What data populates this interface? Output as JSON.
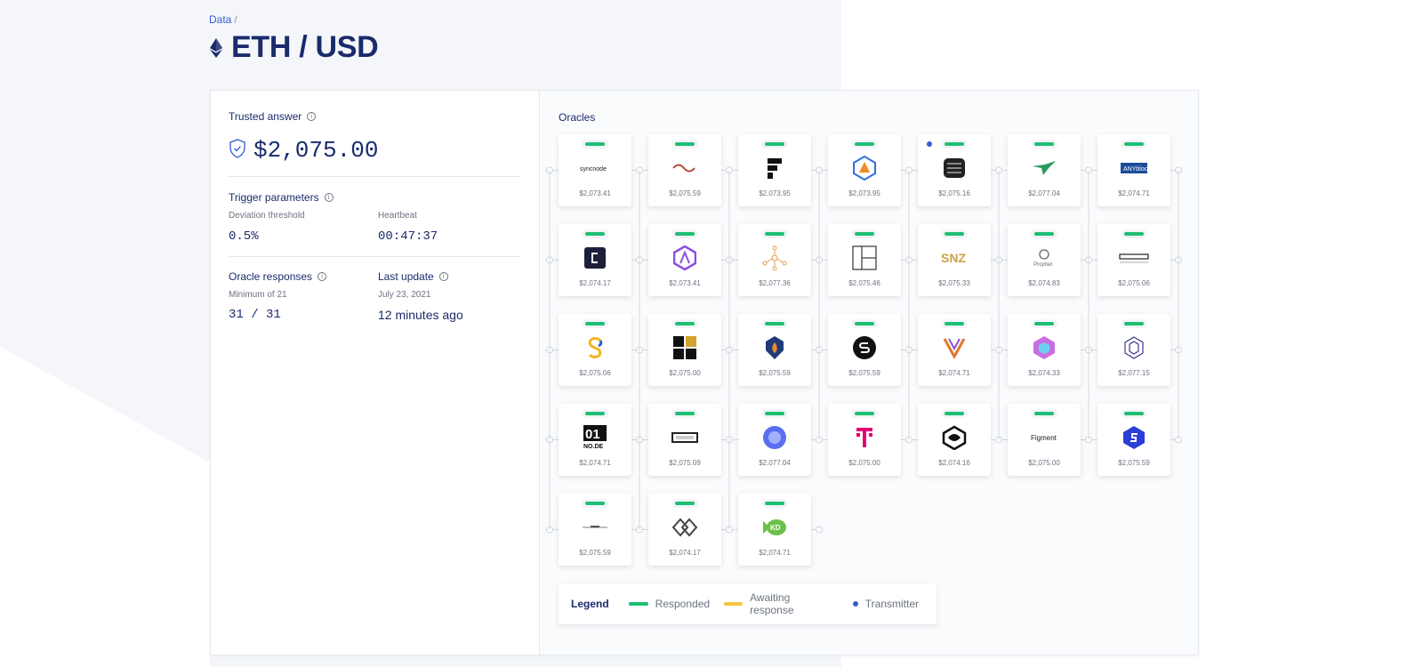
{
  "breadcrumb": {
    "root": "Data",
    "sep": "/"
  },
  "page": {
    "title": "ETH / USD"
  },
  "trusted": {
    "label": "Trusted answer",
    "value": "$2,075.00"
  },
  "trigger": {
    "label": "Trigger parameters",
    "deviation_label": "Deviation threshold",
    "deviation_value": "0.5%",
    "heartbeat_label": "Heartbeat",
    "heartbeat_value": "00:47:37"
  },
  "responses": {
    "label": "Oracle responses",
    "minimum": "Minimum of 21",
    "value": "31 / 31"
  },
  "last_update": {
    "label": "Last update",
    "date": "July 23, 2021",
    "relative": "12 minutes ago"
  },
  "oracles": {
    "title": "Oracles",
    "items": [
      {
        "logo": "syncnode-logo",
        "value": "$2,073.41",
        "status": "responded",
        "transmitter": false
      },
      {
        "logo": "wave-logo",
        "value": "$2,075.59",
        "status": "responded",
        "transmitter": false
      },
      {
        "logo": "f-logo",
        "value": "$2,073.95",
        "status": "responded",
        "transmitter": false
      },
      {
        "logo": "hexagon-flame-logo",
        "value": "$2,073.95",
        "status": "responded",
        "transmitter": false
      },
      {
        "logo": "stack-logo",
        "value": "$2,075.16",
        "status": "responded",
        "transmitter": true
      },
      {
        "logo": "bird-logo",
        "value": "$2,077.04",
        "status": "responded",
        "transmitter": false
      },
      {
        "logo": "anyblock-logo",
        "value": "$2,074.71",
        "status": "responded",
        "transmitter": false
      },
      {
        "logo": "tc-logo",
        "value": "$2,074.17",
        "status": "responded",
        "transmitter": false
      },
      {
        "logo": "a-hexagon-logo",
        "value": "$2,073.41",
        "status": "responded",
        "transmitter": false
      },
      {
        "logo": "network-nodes-logo",
        "value": "$2,077.36",
        "status": "responded",
        "transmitter": false
      },
      {
        "logo": "window-logo",
        "value": "$2,075.46",
        "status": "responded",
        "transmitter": false
      },
      {
        "logo": "snz-logo",
        "value": "$2,075.33",
        "status": "responded",
        "transmitter": false
      },
      {
        "logo": "prophet-logo",
        "value": "$2,074.83",
        "status": "responded",
        "transmitter": false
      },
      {
        "logo": "ceo-logo",
        "value": "$2,075.06",
        "status": "responded",
        "transmitter": false
      },
      {
        "logo": "chain-s-logo",
        "value": "$2,075.06",
        "status": "responded",
        "transmitter": false
      },
      {
        "logo": "blocks-logo",
        "value": "$2,075.00",
        "status": "responded",
        "transmitter": false
      },
      {
        "logo": "shield-flame-logo",
        "value": "$2,075.59",
        "status": "responded",
        "transmitter": false
      },
      {
        "logo": "circle-s-logo",
        "value": "$2,075.59",
        "status": "responded",
        "transmitter": false
      },
      {
        "logo": "v-logo",
        "value": "$2,074.71",
        "status": "responded",
        "transmitter": false
      },
      {
        "logo": "cube-logo",
        "value": "$2,074.33",
        "status": "responded",
        "transmitter": false
      },
      {
        "logo": "hex-outline-logo",
        "value": "$2,077.15",
        "status": "responded",
        "transmitter": false
      },
      {
        "logo": "01-node-logo",
        "value": "$2,074.71",
        "status": "responded",
        "transmitter": false
      },
      {
        "logo": "rect-badge-logo",
        "value": "$2,075.09",
        "status": "responded",
        "transmitter": false
      },
      {
        "logo": "blue-blob-logo",
        "value": "$2,077.04",
        "status": "responded",
        "transmitter": false
      },
      {
        "logo": "t-mobile-logo",
        "value": "$2,075.00",
        "status": "responded",
        "transmitter": false
      },
      {
        "logo": "hex-eye-logo",
        "value": "$2,074.16",
        "status": "responded",
        "transmitter": false
      },
      {
        "logo": "figment-logo",
        "value": "$2,075.00",
        "status": "responded",
        "transmitter": false
      },
      {
        "logo": "blue-s-hex-logo",
        "value": "$2,075.59",
        "status": "responded",
        "transmitter": false
      },
      {
        "logo": "line-logo",
        "value": "$2,075.59",
        "status": "responded",
        "transmitter": false
      },
      {
        "logo": "diamond-logo",
        "value": "$2,074.17",
        "status": "responded",
        "transmitter": false
      },
      {
        "logo": "green-fish-logo",
        "value": "$2,074.71",
        "status": "responded",
        "transmitter": false
      }
    ]
  },
  "legend": {
    "title": "Legend",
    "responded": "Responded",
    "awaiting": "Awaiting response",
    "transmitter": "Transmitter"
  },
  "colors": {
    "responded": "#1dbf73",
    "awaiting": "#f5c542",
    "transmitter": "#375bd2",
    "brand_navy": "#1a2b6b"
  }
}
